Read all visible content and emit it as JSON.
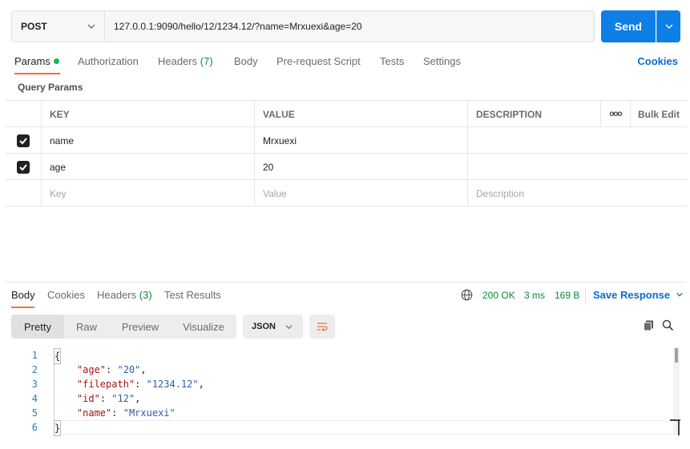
{
  "request": {
    "method": "POST",
    "url": "127.0.0.1:9090/hello/12/1234.12/?name=Mrxuexi&age=20",
    "send_label": "Send"
  },
  "request_tabs": [
    {
      "label": "Params",
      "active": true
    },
    {
      "label": "Authorization"
    },
    {
      "label": "Headers",
      "count": "(7)"
    },
    {
      "label": "Body"
    },
    {
      "label": "Pre-request Script"
    },
    {
      "label": "Tests"
    },
    {
      "label": "Settings"
    }
  ],
  "cookies_link": "Cookies",
  "query_params_label": "Query Params",
  "params_table": {
    "headers": {
      "key": "KEY",
      "value": "VALUE",
      "description": "DESCRIPTION",
      "more": "ooo",
      "bulk_edit": "Bulk Edit"
    },
    "rows": [
      {
        "key": "name",
        "value": "Mrxuexi",
        "description": "",
        "checked": true
      },
      {
        "key": "age",
        "value": "20",
        "description": "",
        "checked": true
      }
    ],
    "placeholder": {
      "key": "Key",
      "value": "Value",
      "description": "Description"
    }
  },
  "response_tabs": [
    {
      "label": "Body",
      "active": true
    },
    {
      "label": "Cookies"
    },
    {
      "label": "Headers",
      "count": "(3)"
    },
    {
      "label": "Test Results"
    }
  ],
  "response_status": {
    "status": "200 OK",
    "time": "3 ms",
    "size": "169 B",
    "save_label": "Save Response"
  },
  "view_modes": [
    "Pretty",
    "Raw",
    "Preview",
    "Visualize"
  ],
  "format_select": "JSON",
  "code_lines": [
    {
      "n": "1",
      "text": "{"
    },
    {
      "n": "2",
      "key": "\"age\"",
      "val": "\"20\"",
      "comma": ","
    },
    {
      "n": "3",
      "key": "\"filepath\"",
      "val": "\"1234.12\"",
      "comma": ","
    },
    {
      "n": "4",
      "key": "\"id\"",
      "val": "\"12\"",
      "comma": ","
    },
    {
      "n": "5",
      "key": "\"name\"",
      "val": "\"Mrxuexi\"",
      "comma": ""
    },
    {
      "n": "6",
      "text": "}"
    }
  ],
  "colors": {
    "accent_orange": "#ff6c37",
    "send_blue": "#0d7fe6",
    "link_blue": "#0b6bcb",
    "status_green": "#0b8a3a"
  },
  "icons": [
    "chevron-down-icon",
    "check-icon",
    "globe-icon",
    "copy-icon",
    "search-icon",
    "wrap-lines-icon"
  ]
}
